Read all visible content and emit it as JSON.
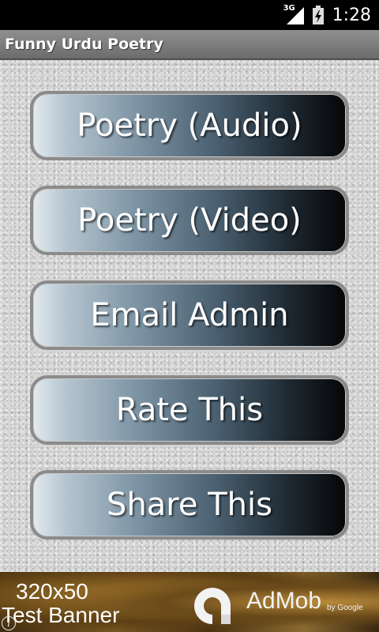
{
  "status_bar": {
    "network": "3G",
    "time": "1:28",
    "icons": [
      "signal-icon",
      "battery-icon"
    ]
  },
  "app": {
    "title": "Funny Urdu Poetry"
  },
  "menu": {
    "buttons": [
      {
        "label": "Poetry (Audio)"
      },
      {
        "label": "Poetry (Video)"
      },
      {
        "label": "Email Admin"
      },
      {
        "label": "Rate This"
      },
      {
        "label": "Share This"
      }
    ]
  },
  "ad": {
    "line1": "320x50",
    "line2": "Test Banner",
    "brand": "AdMob",
    "byline": "by Google",
    "info_icon": "i"
  },
  "colors": {
    "title_bar": "#7d7d7d",
    "button_border": "#8b8b8b",
    "button_gradient_start": "#e3eaef",
    "button_gradient_end": "#050607"
  }
}
